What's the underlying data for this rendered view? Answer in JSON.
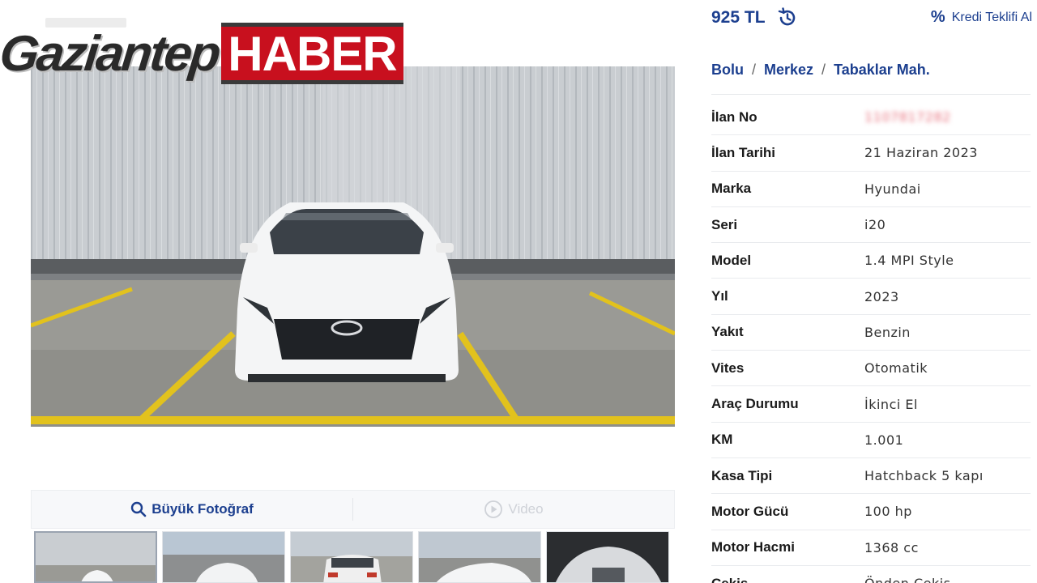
{
  "watermark": {
    "city": "Gaziantep",
    "brand": "HABER"
  },
  "price": {
    "amount": "925 TL",
    "history_icon": "history-icon"
  },
  "credit": {
    "label": "Kredi Teklifi Al",
    "icon": "percent-icon"
  },
  "breadcrumb": [
    "Bolu",
    "Merkez",
    "Tabaklar Mah."
  ],
  "media": {
    "photo_label": "Büyük Fotoğraf",
    "video_label": "Video",
    "thumbnail_count": 5
  },
  "details": [
    {
      "label": "İlan No",
      "value": "1107817282",
      "blurred": true
    },
    {
      "label": "İlan Tarihi",
      "value": "21 Haziran 2023"
    },
    {
      "label": "Marka",
      "value": "Hyundai"
    },
    {
      "label": "Seri",
      "value": "i20"
    },
    {
      "label": "Model",
      "value": "1.4 MPI Style"
    },
    {
      "label": "Yıl",
      "value": "2023"
    },
    {
      "label": "Yakıt",
      "value": "Benzin"
    },
    {
      "label": "Vites",
      "value": "Otomatik"
    },
    {
      "label": "Araç Durumu",
      "value": "İkinci El"
    },
    {
      "label": "KM",
      "value": "1.001"
    },
    {
      "label": "Kasa Tipi",
      "value": "Hatchback 5 kapı"
    },
    {
      "label": "Motor Gücü",
      "value": "100 hp"
    },
    {
      "label": "Motor Hacmi",
      "value": "1368 cc"
    },
    {
      "label": "Çekiş",
      "value": "Önden Çekiş"
    }
  ],
  "colors": {
    "accent": "#1c3f8f",
    "brand_red": "#c8101e"
  }
}
